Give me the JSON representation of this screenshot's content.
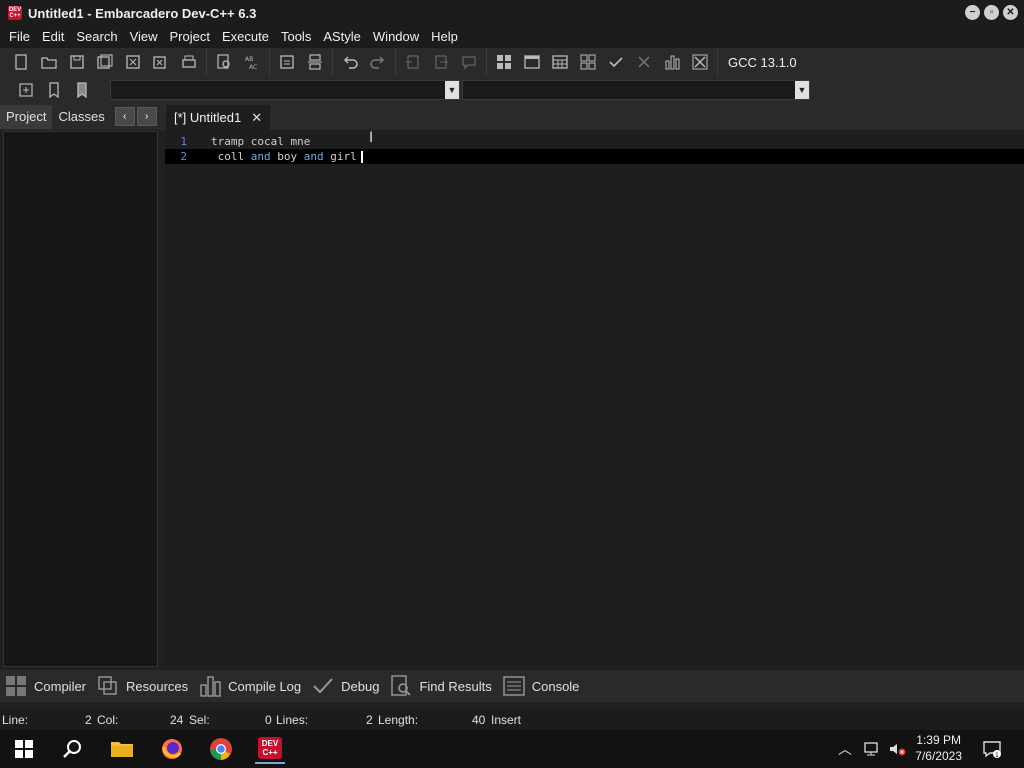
{
  "window": {
    "title": "Untitled1 - Embarcadero Dev-C++ 6.3",
    "app_icon_text": "DEV C++",
    "controls": [
      "minimize-icon",
      "restore-icon",
      "close-icon"
    ]
  },
  "menu": [
    "File",
    "Edit",
    "Search",
    "View",
    "Project",
    "Execute",
    "Tools",
    "AStyle",
    "Window",
    "Help"
  ],
  "toolbar": {
    "compiler_label": "GCC 13.1.0"
  },
  "left_panel": {
    "tabs": [
      "Project",
      "Classes"
    ],
    "prev_arrow": "‹",
    "next_arrow": "›"
  },
  "editor": {
    "tab_label": "[*] Untitled1",
    "tab_close": "✕",
    "lines": [
      {
        "number": "1",
        "text": "tramp cocal mne"
      },
      {
        "number": "2",
        "parts": [
          " coll ",
          "and",
          " boy ",
          "and",
          " girl"
        ]
      }
    ]
  },
  "bottom_tabs": [
    "Compiler",
    "Resources",
    "Compile Log",
    "Debug",
    "Find Results",
    "Console"
  ],
  "status": {
    "line_label": "Line:",
    "line_value": "2",
    "col_label": "Col:",
    "col_value": "24",
    "sel_label": "Sel:",
    "sel_value": "0",
    "lines_label": "Lines:",
    "lines_value": "2",
    "length_label": "Length:",
    "length_value": "40",
    "mode": "Insert"
  },
  "taskbar": {
    "time": "1:39 PM",
    "date": "7/6/2023",
    "apps": [
      "windows-start-icon",
      "search-icon",
      "file-explorer-icon",
      "firefox-icon",
      "chrome-icon",
      "devcpp-icon"
    ]
  },
  "colors": {
    "background": "#202020",
    "editor_bg": "#1e1e1e",
    "line_number": "#5a8fd0",
    "keyword": "#7aa7d9",
    "current_line": "#000000"
  }
}
